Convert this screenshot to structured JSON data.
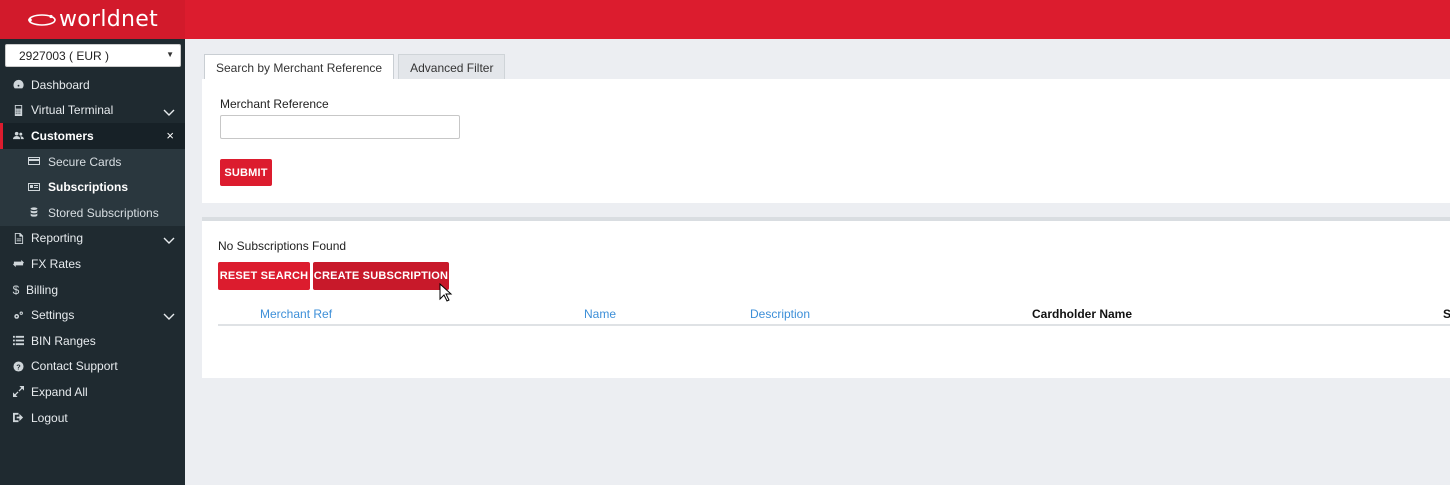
{
  "brand": {
    "logo_text": "worldnet",
    "accent": "#dc1c2e"
  },
  "account": {
    "selected": "2927003 ( EUR )"
  },
  "sidebar": {
    "items": [
      {
        "label": "Dashboard",
        "icon": "dashboard-icon"
      },
      {
        "label": "Virtual Terminal",
        "icon": "calculator-icon",
        "expandable": true
      },
      {
        "label": "Customers",
        "icon": "users-icon",
        "active": true
      },
      {
        "label": "Reporting",
        "icon": "report-icon",
        "expandable": true
      },
      {
        "label": "FX Rates",
        "icon": "exchange-icon"
      },
      {
        "label": "Billing",
        "icon": "dollar-icon"
      },
      {
        "label": "Settings",
        "icon": "gears-icon",
        "expandable": true
      },
      {
        "label": "BIN Ranges",
        "icon": "list-icon"
      },
      {
        "label": "Contact Support",
        "icon": "question-icon"
      },
      {
        "label": "Expand All",
        "icon": "expand-icon"
      },
      {
        "label": "Logout",
        "icon": "logout-icon"
      }
    ],
    "customers_sub": [
      {
        "label": "Secure Cards",
        "icon": "credit-card-icon"
      },
      {
        "label": "Subscriptions",
        "icon": "id-card-icon",
        "current": true
      },
      {
        "label": "Stored Subscriptions",
        "icon": "database-icon"
      }
    ],
    "close_glyph": "×"
  },
  "tabs": [
    {
      "label": "Search by Merchant Reference",
      "active": true
    },
    {
      "label": "Advanced Filter",
      "active": false
    }
  ],
  "search": {
    "field_label": "Merchant Reference",
    "field_value": "",
    "submit_label": "SUBMIT"
  },
  "results": {
    "status_text": "No Subscriptions Found",
    "reset_label": "RESET SEARCH",
    "create_label": "CREATE SUBSCRIPTION",
    "columns": [
      "Merchant Ref",
      "Name",
      "Description",
      "Cardholder Name",
      "S"
    ]
  }
}
